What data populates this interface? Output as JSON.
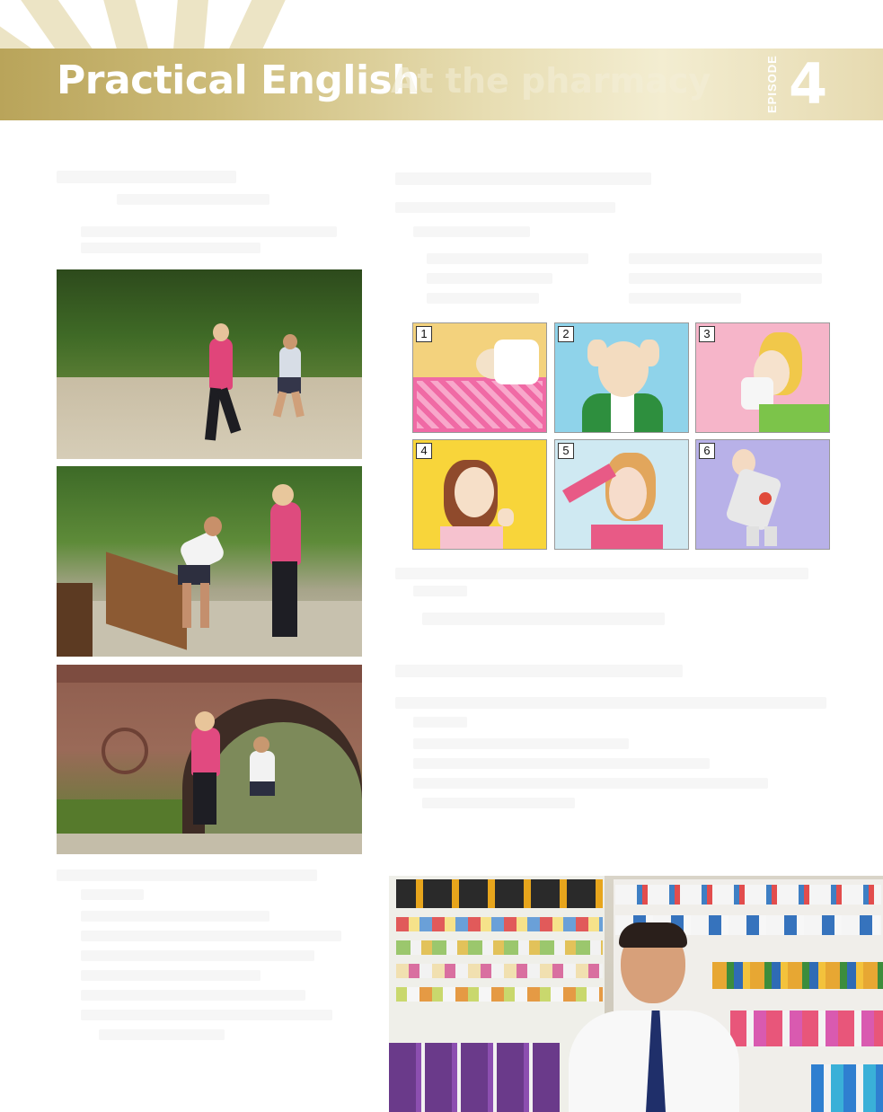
{
  "header": {
    "title": "Practical English",
    "subtitle": "At the pharmacy",
    "episode_word": "EPISODE",
    "episode_number": "4"
  },
  "illustrations": [
    {
      "label": "1"
    },
    {
      "label": "2"
    },
    {
      "label": "3"
    },
    {
      "label": "4"
    },
    {
      "label": "5"
    },
    {
      "label": "6"
    }
  ],
  "colors": {
    "banner_gold": "#c7b66f",
    "ill1_bg": "#f2c96a",
    "ill2_bg": "#8fd0e8",
    "ill3_bg": "#f5b8c8",
    "ill4_bg": "#f7d23a",
    "ill5_bg": "#c9e6ef",
    "ill6_bg": "#b7b0e6"
  }
}
